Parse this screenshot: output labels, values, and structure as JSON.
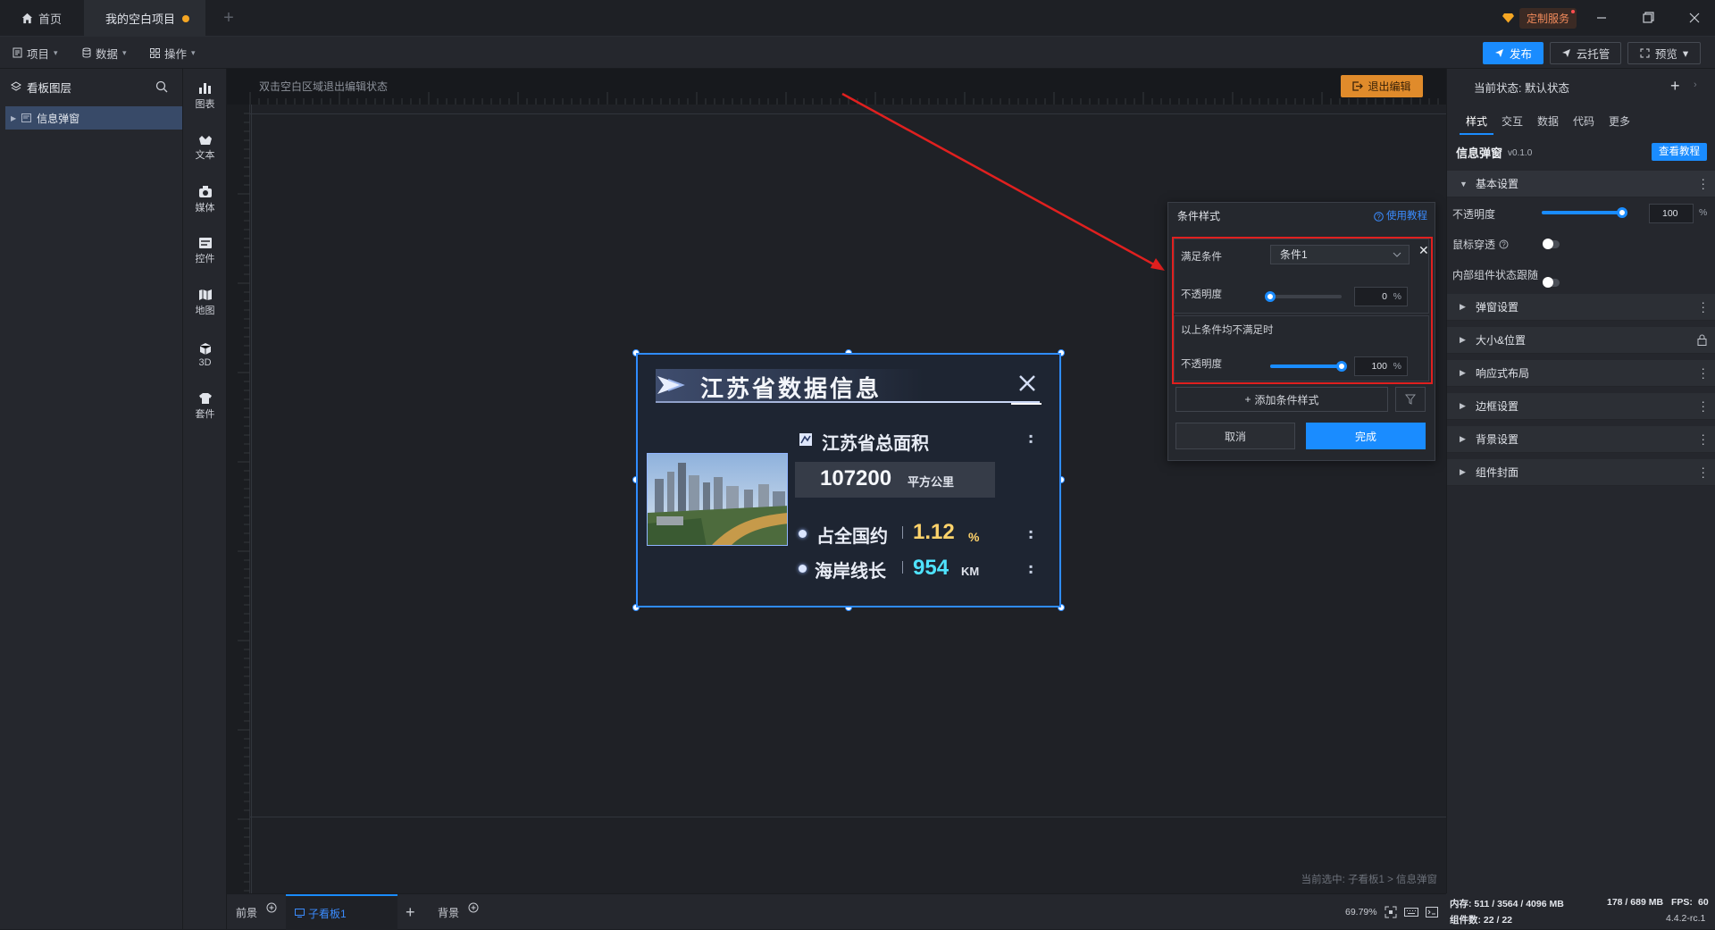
{
  "titlebar": {
    "home_tab": "首页",
    "project_tab": "我的空白项目",
    "add_tab": "+",
    "custom_service": "定制服务"
  },
  "menubar": {
    "project": "项目",
    "data": "数据",
    "operate": "操作",
    "publish": "发布",
    "cloud_hosting": "云托管",
    "preview": "预览"
  },
  "layers": {
    "title": "看板图层",
    "items": [
      {
        "label": "信息弹窗"
      }
    ]
  },
  "toolbox": {
    "items": [
      {
        "label": "图表",
        "icon": "chart-icon"
      },
      {
        "label": "文本",
        "icon": "text-icon"
      },
      {
        "label": "媒体",
        "icon": "media-icon"
      },
      {
        "label": "控件",
        "icon": "control-icon"
      },
      {
        "label": "地图",
        "icon": "map-icon"
      },
      {
        "label": "3D",
        "icon": "cube-icon"
      },
      {
        "label": "套件",
        "icon": "kit-icon"
      }
    ]
  },
  "canvas": {
    "hint": "双击空白区域退出编辑状态",
    "exit_edit": "退出编辑",
    "selected_path": "当前选中: 子看板1 > 信息弹窗"
  },
  "popup_card": {
    "title": "江苏省数据信息",
    "area_label": "江苏省总面积",
    "area_value": "107200",
    "area_unit": "平方公里",
    "share_label": "占全国约",
    "share_value": "1.12",
    "share_unit": "%",
    "coast_label": "海岸线长",
    "coast_value": "954",
    "coast_unit": "KM",
    "accent_yellow": "#ffd36b",
    "accent_cyan": "#4fe3ff"
  },
  "condition_dialog": {
    "title": "条件样式",
    "tutorial_link": "使用教程",
    "condition_label": "满足条件",
    "condition_value": "条件1",
    "opacity_label": "不透明度",
    "opacity_value": "0",
    "opacity_level": 0,
    "unit": "%",
    "else_label": "以上条件均不满足时",
    "else_opacity_label": "不透明度",
    "else_opacity_value": "100",
    "else_opacity_level": 100,
    "add_condition": "添加条件样式",
    "cancel": "取消",
    "done": "完成"
  },
  "properties": {
    "current_state": "当前状态: 默认状态",
    "tabs": [
      "样式",
      "交互",
      "数据",
      "代码",
      "更多"
    ],
    "component_name": "信息弹窗",
    "component_version": "v0.1.0",
    "view_tutorial": "查看教程",
    "basic_settings": "基本设置",
    "opacity_label": "不透明度",
    "opacity_value": "100",
    "opacity_level": 100,
    "unit": "%",
    "mouse_through": "鼠标穿透",
    "inner_follow": "内部组件状态跟随",
    "sections": [
      {
        "label": "弹窗设置"
      },
      {
        "label": "大小&位置"
      },
      {
        "label": "响应式布局"
      },
      {
        "label": "边框设置"
      },
      {
        "label": "背景设置"
      },
      {
        "label": "组件封面"
      }
    ]
  },
  "bottombar": {
    "foreground": "前景",
    "sub_board": "子看板1",
    "background": "背景",
    "zoom": "69.79%"
  },
  "sysinfo": {
    "memory": "内存: 511 / 3564 / 4096 MB",
    "gpu": "178 / 689 MB",
    "fps_label": "FPS:",
    "fps_value": "60",
    "components": "组件数: 22 / 22",
    "version": "4.4.2-rc.1"
  }
}
